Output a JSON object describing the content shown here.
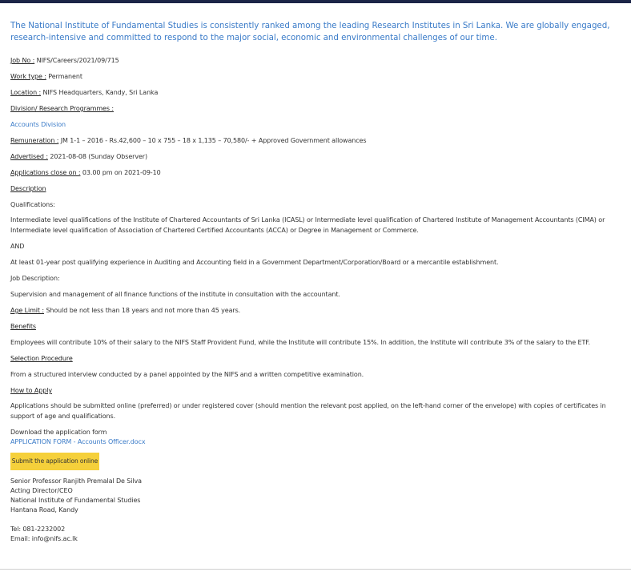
{
  "intro": "The National Institute of Fundamental Studies is consistently ranked among the leading Research Institutes in Sri Lanka. We are globally engaged, research-intensive and committed to respond to the major social, economic and environmental challenges of our time.",
  "job": {
    "job_no_label": "Job No :",
    "job_no": " NIFS/Careers/2021/09/715",
    "work_type_label": "Work type :",
    "work_type": " Permanent",
    "location_label": "Location :",
    "location": " NIFS Headquarters, Kandy, Sri Lanka",
    "division_label": "Division/ Research Programmes :",
    "division": "Accounts Division",
    "remuneration_label": "Remuneration :",
    "remuneration": " JM 1-1 – 2016 - Rs.42,600 – 10 x 755 – 18 x 1,135 – 70,580/- + Approved Government allowances",
    "advertised_label": "Advertised :",
    "advertised": " 2021-08-08 (Sunday Observer)",
    "close_label": "Applications close on :",
    "close": " 03.00 pm on 2021-09-10"
  },
  "description": {
    "heading": "Description",
    "qualifications_label": "Qualifications:",
    "qualifications": "Intermediate level qualifications of the Institute of Chartered Accountants of Sri Lanka (ICASL) or Intermediate level qualification of Chartered Institute of Management Accountants (CIMA) or Intermediate level qualification of Association of Chartered Certified Accountants (ACCA) or Degree in Management or Commerce.",
    "and": "AND",
    "experience": "At least 01-year post qualifying experience in Auditing and Accounting field in a Government Department/Corporation/Board or a mercantile establishment.",
    "job_description_label": "Job Description:",
    "job_description": "Supervision and management of all finance functions of the institute in consultation with the accountant.",
    "age_limit_label": "Age Limit :",
    "age_limit": " Should be not less than 18 years and not more than 45 years."
  },
  "benefits": {
    "heading": "Benefits",
    "text": "Employees will contribute 10% of their salary to the NIFS Staff Provident Fund, while the Institute will contribute 15%. In addition, the Institute will contribute 3% of the salary to the ETF."
  },
  "selection": {
    "heading": "Selection Procedure",
    "text": "From a structured interview conducted by a panel appointed by the NIFS and a written competitive examination."
  },
  "apply": {
    "heading": "How to Apply",
    "text": "Applications should be submitted online (preferred) or under registered cover (should mention the relevant post applied, on the left-hand corner of the envelope) with copies of certificates in support of age and qualifications.",
    "download_label": "Download the application form",
    "form_link": "APPLICATION FORM - Accounts Officer.docx",
    "submit_button": "Submit the application online"
  },
  "signature": {
    "name": "Senior Professor Ranjith Premalal De Silva",
    "title": "Acting Director/CEO",
    "org": "National Institute of Fundamental Studies",
    "address": "Hantana Road, Kandy",
    "tel": "Tel: 081-2232002",
    "email": "Email: info@nifs.ac.lk"
  },
  "colors": {
    "accent_blue": "#3a7bc8",
    "button_yellow": "#f5d03b",
    "top_bar": "#1c2547"
  }
}
